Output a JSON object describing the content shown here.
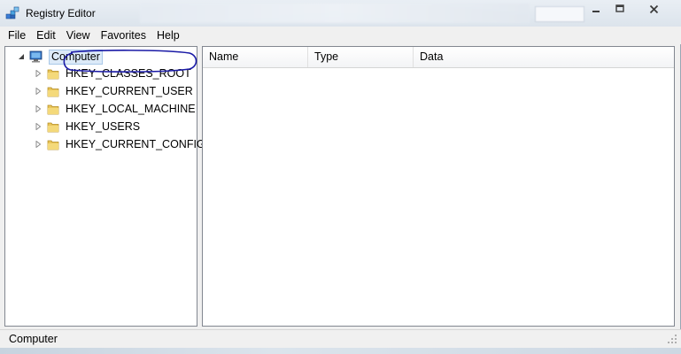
{
  "window": {
    "title": "Registry Editor"
  },
  "menu": [
    {
      "label": "File"
    },
    {
      "label": "Edit"
    },
    {
      "label": "View"
    },
    {
      "label": "Favorites"
    },
    {
      "label": "Help"
    }
  ],
  "tree": {
    "root": {
      "label": "Computer",
      "icon": "computer-icon",
      "expanded": true,
      "selected": true
    },
    "children": [
      {
        "label": "HKEY_CLASSES_ROOT",
        "icon": "folder-icon"
      },
      {
        "label": "HKEY_CURRENT_USER",
        "icon": "folder-icon"
      },
      {
        "label": "HKEY_LOCAL_MACHINE",
        "icon": "folder-icon",
        "annotated": true
      },
      {
        "label": "HKEY_USERS",
        "icon": "folder-icon"
      },
      {
        "label": "HKEY_CURRENT_CONFIG",
        "icon": "folder-icon"
      }
    ]
  },
  "list": {
    "columns": [
      {
        "label": "Name"
      },
      {
        "label": "Type"
      },
      {
        "label": "Data"
      }
    ]
  },
  "status": {
    "text": "Computer"
  },
  "colors": {
    "annotation": "#1a1aa6",
    "selection": "#dceaf8",
    "folder": "#e8c55a"
  }
}
